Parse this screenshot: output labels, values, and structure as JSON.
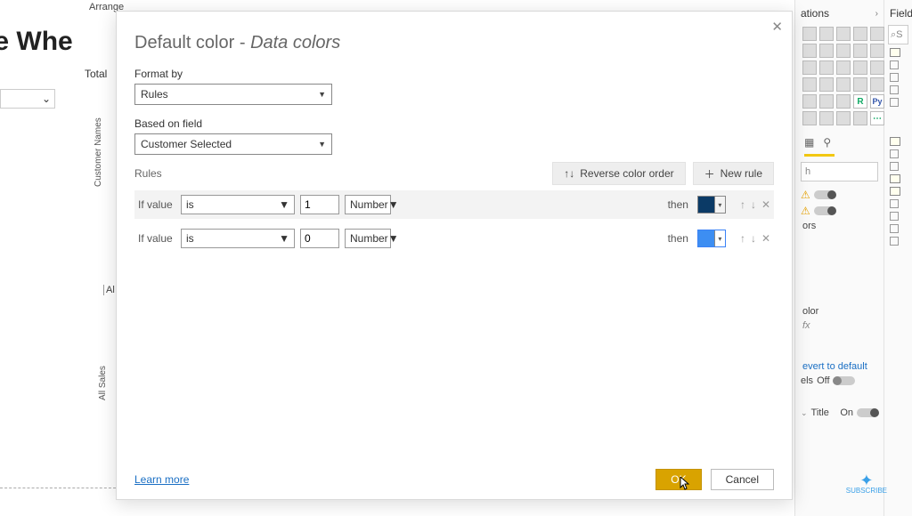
{
  "bg": {
    "ribbon": "Arrange",
    "title_fragment": "ase Whe",
    "total": "Total",
    "ylabel1": "Customer Names",
    "ylabel2": "All Sales",
    "al": "Al"
  },
  "dialog": {
    "title_main": "Default color - ",
    "title_sub": "Data colors",
    "format_by_label": "Format by",
    "format_by_value": "Rules",
    "based_on_label": "Based on field",
    "based_on_value": "Customer Selected",
    "rules_label": "Rules",
    "reverse_btn": "Reverse color order",
    "new_rule_btn": "New rule",
    "rules": [
      {
        "if": "If value",
        "op": "is",
        "val": "1",
        "type": "Number",
        "then": "then",
        "color": "#0b3a66"
      },
      {
        "if": "If value",
        "op": "is",
        "val": "0",
        "type": "Number",
        "then": "then",
        "color": "#3d8ef2"
      }
    ],
    "learn_more": "Learn more",
    "ok": "OK",
    "cancel": "Cancel"
  },
  "right": {
    "vis_head": "ations",
    "fields_head": "Field",
    "search_ph": "S",
    "colors_frag": "ors",
    "color_frag": "olor",
    "revert": "evert to default",
    "labels_frag": "els",
    "off": "Off",
    "title": "Title",
    "on": "On",
    "r": "R",
    "py": "Py",
    "more": "⋯",
    "h": "h"
  },
  "subscribe": "SUBSCRIBE"
}
